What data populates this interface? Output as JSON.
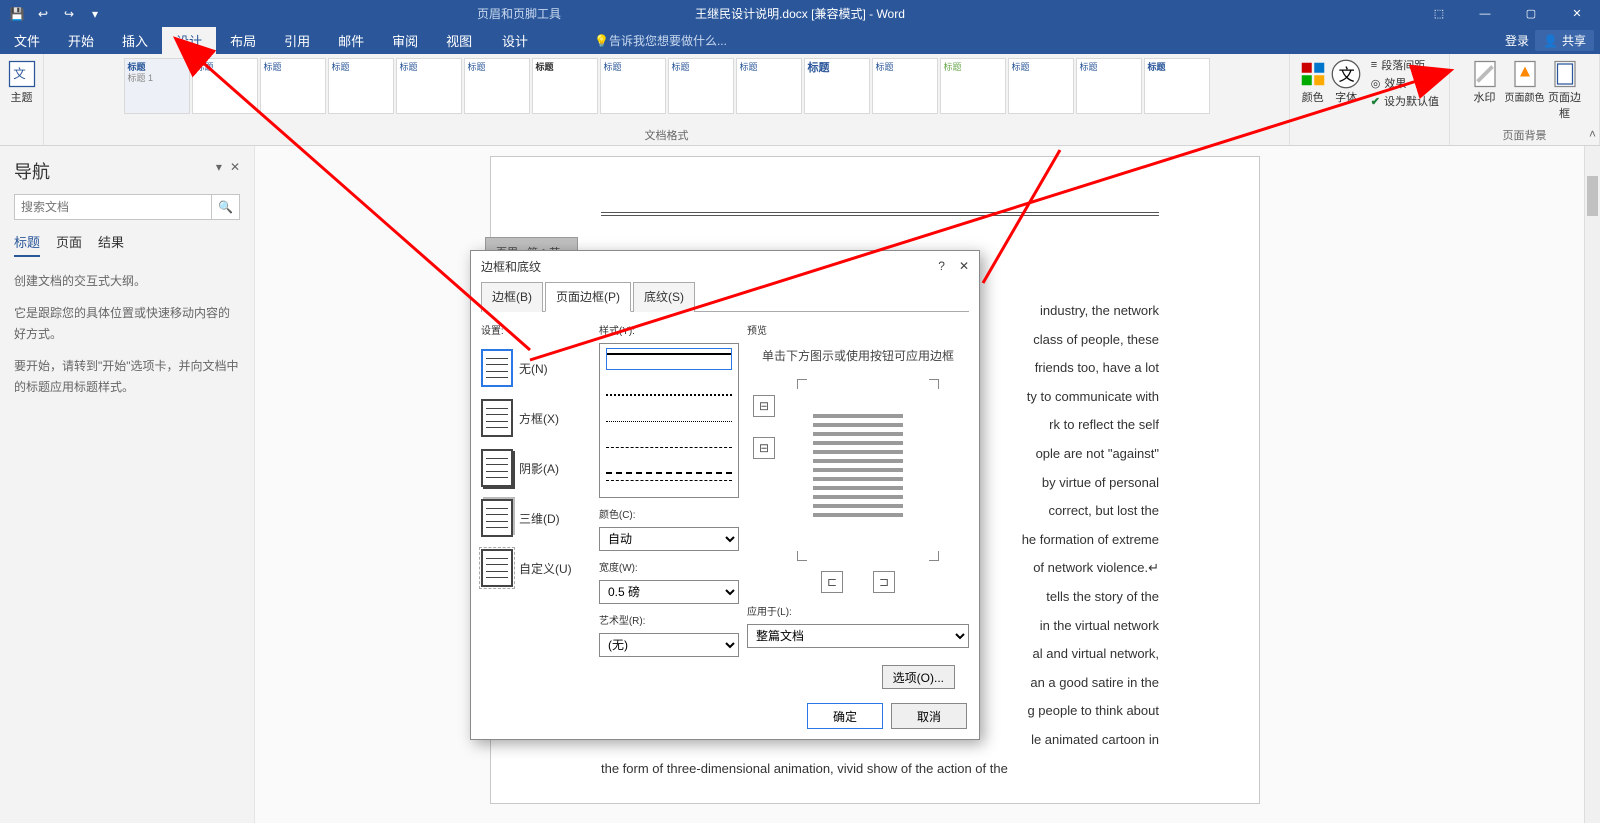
{
  "titlebar": {
    "doc_title": "王继民设计说明.docx [兼容模式] - Word",
    "tool_tab": "页眉和页脚工具"
  },
  "win_controls": {
    "ribbon_opts": "⬚",
    "min": "—",
    "max": "▢",
    "close": "✕"
  },
  "tabs": {
    "file": "文件",
    "home": "开始",
    "insert": "插入",
    "design": "设计",
    "layout": "布局",
    "references": "引用",
    "mailings": "邮件",
    "review": "审阅",
    "view": "视图",
    "tool_design": "设计",
    "tellme": "告诉我您想要做什么...",
    "login": "登录",
    "share": "共享"
  },
  "ribbon": {
    "theme_btn": "主题",
    "style_thumb": "标题",
    "gallery_group": "文档格式",
    "colors": "颜色",
    "fonts": "字体",
    "para_spacing": "段落间距",
    "effects": "效果",
    "set_default": "设为默认值",
    "watermark": "水印",
    "page_color": "页面颜色",
    "page_border": "页面边框",
    "bg_group": "页面背景"
  },
  "nav": {
    "title": "导航",
    "search_placeholder": "搜索文档",
    "tab_headings": "标题",
    "tab_pages": "页面",
    "tab_results": "结果",
    "helper1": "创建文档的交互式大纲。",
    "helper2": "它是跟踪您的具体位置或快速移动内容的好方式。",
    "helper3": "要开始，请转到\"开始\"选项卡，并向文档中的标题应用标题样式。"
  },
  "page": {
    "header_tag": "页眉 - 第 1 节 -",
    "lines": [
      "industry, the network",
      "class of people, these",
      "friends too, have a lot",
      "ty to communicate with",
      "rk to reflect the self",
      "ople are not \"against\"",
      "by virtue of personal",
      "correct, but lost the",
      "he formation of extreme",
      "of network violence.↵",
      "tells the story of the",
      "in the virtual network",
      "al and virtual network,",
      "an a good satire in the",
      "g people to think about",
      "le animated cartoon in",
      "the form of three-dimensional animation, vivid show of the action of the"
    ]
  },
  "dialog": {
    "title": "边框和底纹",
    "help": "?",
    "close": "✕",
    "tab_border": "边框(B)",
    "tab_page_border": "页面边框(P)",
    "tab_shading": "底纹(S)",
    "setting": "设置:",
    "opt_none": "无(N)",
    "opt_box": "方框(X)",
    "opt_shadow": "阴影(A)",
    "opt_3d": "三维(D)",
    "opt_custom": "自定义(U)",
    "style_label": "样式(Y):",
    "color_label": "颜色(C):",
    "color_value": "自动",
    "width_label": "宽度(W):",
    "width_value": "0.5 磅",
    "art_label": "艺术型(R):",
    "art_value": "(无)",
    "preview_label": "预览",
    "preview_hint": "单击下方图示或使用按钮可应用边框",
    "apply_label": "应用于(L):",
    "apply_value": "整篇文档",
    "options_btn": "选项(O)...",
    "ok": "确定",
    "cancel": "取消"
  }
}
